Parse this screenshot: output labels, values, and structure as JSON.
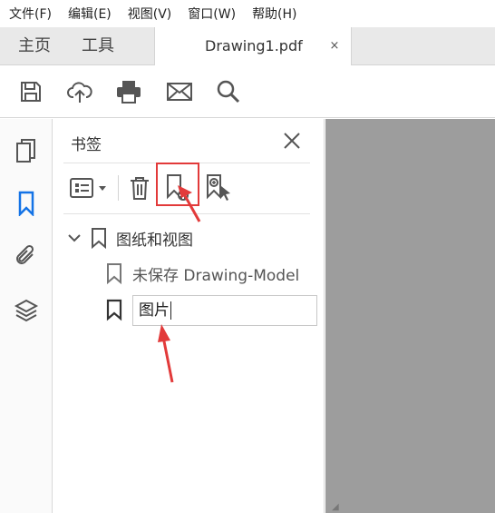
{
  "menubar": {
    "items": [
      "文件(F)",
      "编辑(E)",
      "视图(V)",
      "窗口(W)",
      "帮助(H)"
    ]
  },
  "tabs": {
    "home": "主页",
    "tools": "工具",
    "document": "Drawing1.pdf",
    "close_glyph": "×"
  },
  "toolbar": {
    "icons": [
      "save-icon",
      "cloud-upload-icon",
      "print-icon",
      "mail-icon",
      "search-icon"
    ]
  },
  "rail": {
    "icons": [
      "pages-icon",
      "bookmark-icon",
      "attachment-icon",
      "layers-icon"
    ],
    "active": "bookmark-icon"
  },
  "bookmarks_panel": {
    "title": "书签",
    "toolbar_icons": [
      "options-menu-icon",
      "delete-icon",
      "new-bookmark-icon",
      "bookmark-from-selection-icon"
    ],
    "items": [
      {
        "label": "图纸和视图",
        "expanded": true,
        "level": 0
      },
      {
        "label": "未保存 Drawing-Model",
        "level": 1
      }
    ],
    "editing_value": "图片"
  },
  "colors": {
    "accent": "#1473e6",
    "annotation_red": "#e23a3a",
    "doc_background": "#9d9d9d"
  }
}
